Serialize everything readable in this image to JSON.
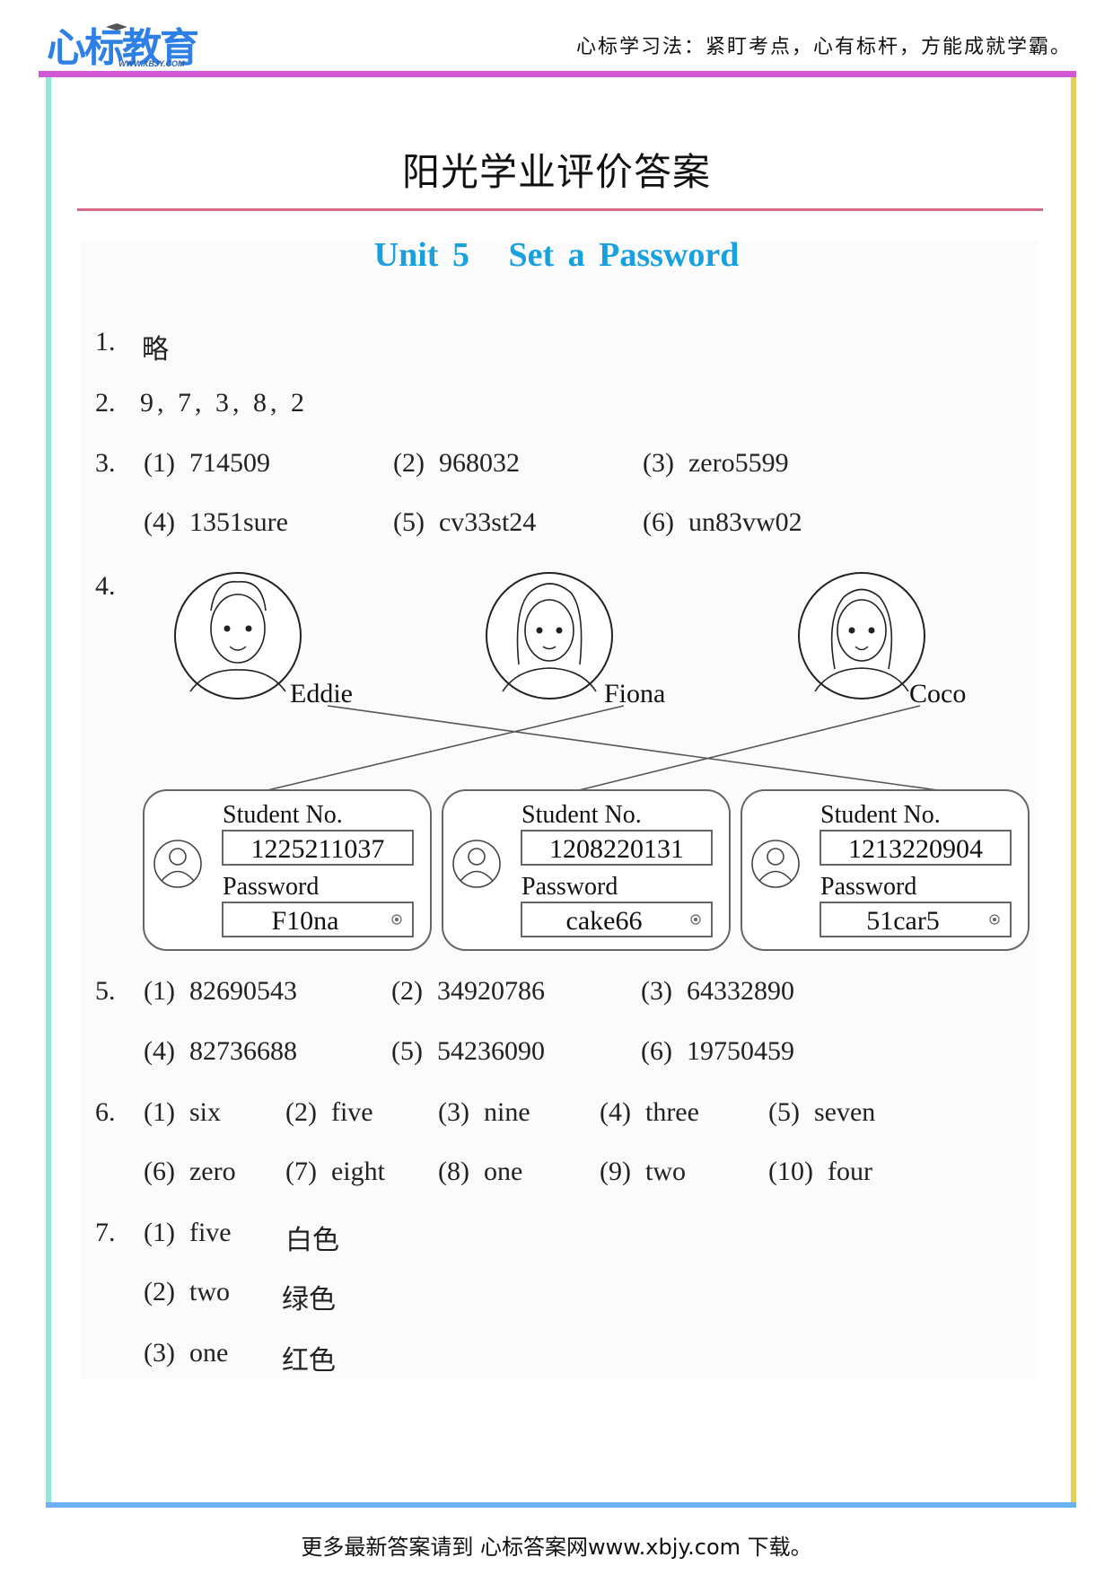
{
  "header": {
    "logo_text": "心标教育",
    "logo_url_text": "WWW.XBJY.COM",
    "slogan": "心标学习法：紧盯考点，心有标杆，方能成就学霸。"
  },
  "document": {
    "title": "阳光学业评价答案",
    "unit_label": "Unit 5",
    "unit_title": "Set a Password"
  },
  "answers": {
    "q1": {
      "num": "1.",
      "text": "略"
    },
    "q2": {
      "num": "2.",
      "text": "9, 7, 3, 8, 2"
    },
    "q3": {
      "num": "3.",
      "items": [
        {
          "label": "(1)",
          "value": "714509"
        },
        {
          "label": "(2)",
          "value": "968032"
        },
        {
          "label": "(3)",
          "value": "zero5599"
        },
        {
          "label": "(4)",
          "value": "1351sure"
        },
        {
          "label": "(5)",
          "value": "cv33st24"
        },
        {
          "label": "(6)",
          "value": "un83vw02"
        }
      ]
    },
    "q4": {
      "num": "4.",
      "people": [
        {
          "name": "Eddie",
          "matches_card": 3
        },
        {
          "name": "Fiona",
          "matches_card": 1
        },
        {
          "name": "Coco",
          "matches_card": 2
        }
      ],
      "cards": [
        {
          "student_label": "Student No.",
          "student_no": "1225211037",
          "password_label": "Password",
          "password": "F10na"
        },
        {
          "student_label": "Student No.",
          "student_no": "1208220131",
          "password_label": "Password",
          "password": "cake66"
        },
        {
          "student_label": "Student No.",
          "student_no": "1213220904",
          "password_label": "Password",
          "password": "51car5"
        }
      ]
    },
    "q5": {
      "num": "5.",
      "items": [
        {
          "label": "(1)",
          "value": "82690543"
        },
        {
          "label": "(2)",
          "value": "34920786"
        },
        {
          "label": "(3)",
          "value": "64332890"
        },
        {
          "label": "(4)",
          "value": "82736688"
        },
        {
          "label": "(5)",
          "value": "54236090"
        },
        {
          "label": "(6)",
          "value": "19750459"
        }
      ]
    },
    "q6": {
      "num": "6.",
      "items": [
        {
          "label": "(1)",
          "value": "six"
        },
        {
          "label": "(2)",
          "value": "five"
        },
        {
          "label": "(3)",
          "value": "nine"
        },
        {
          "label": "(4)",
          "value": "three"
        },
        {
          "label": "(5)",
          "value": "seven"
        },
        {
          "label": "(6)",
          "value": "zero"
        },
        {
          "label": "(7)",
          "value": "eight"
        },
        {
          "label": "(8)",
          "value": "one"
        },
        {
          "label": "(9)",
          "value": "two"
        },
        {
          "label": "(10)",
          "value": "four"
        }
      ]
    },
    "q7": {
      "num": "7.",
      "items": [
        {
          "label": "(1)",
          "value": "five",
          "color": "白色"
        },
        {
          "label": "(2)",
          "value": "two",
          "color": "绿色"
        },
        {
          "label": "(3)",
          "value": "one",
          "color": "红色"
        }
      ]
    }
  },
  "footer": {
    "text": "更多最新答案请到 心标答案网www.xbjy.com 下载。"
  },
  "colors": {
    "top_bar": "#d157d6",
    "left_bar": "#8ee8dc",
    "right_bar": "#e6cf58",
    "bottom_bar": "#6cb2f2",
    "title_rule": "#d66a88",
    "unit_title": "#1aa1dd",
    "logo": "#2e7fe6"
  }
}
